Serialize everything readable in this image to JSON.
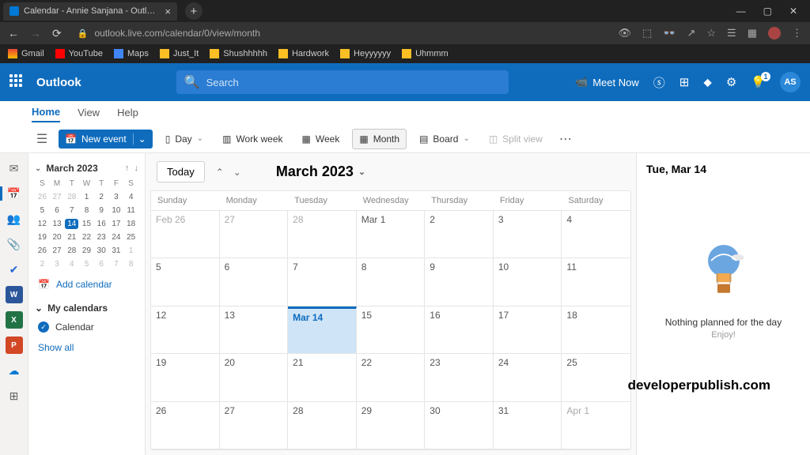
{
  "browser": {
    "tab_title": "Calendar - Annie Sanjana - Outl…",
    "url": "outlook.live.com/calendar/0/view/month",
    "bookmarks": [
      "Gmail",
      "YouTube",
      "Maps",
      "Just_It",
      "Shushhhhh",
      "Hardwork",
      "Heyyyyyy",
      "Uhmmm"
    ]
  },
  "suite": {
    "app_name": "Outlook",
    "search_placeholder": "Search",
    "meet_now": "Meet Now",
    "avatar_initials": "AS"
  },
  "ribbon_tabs": {
    "home": "Home",
    "view": "View",
    "help": "Help"
  },
  "ribbon": {
    "new_event": "New event",
    "day": "Day",
    "workweek": "Work week",
    "week": "Week",
    "month": "Month",
    "board": "Board",
    "split": "Split view"
  },
  "sidebar": {
    "month_header": "March 2023",
    "dow": [
      "S",
      "M",
      "T",
      "W",
      "T",
      "F",
      "S"
    ],
    "mini_weeks": [
      [
        {
          "d": "26",
          "dim": true
        },
        {
          "d": "27",
          "dim": true
        },
        {
          "d": "28",
          "dim": true
        },
        {
          "d": "1"
        },
        {
          "d": "2"
        },
        {
          "d": "3"
        },
        {
          "d": "4"
        }
      ],
      [
        {
          "d": "5"
        },
        {
          "d": "6"
        },
        {
          "d": "7"
        },
        {
          "d": "8"
        },
        {
          "d": "9"
        },
        {
          "d": "10"
        },
        {
          "d": "11"
        }
      ],
      [
        {
          "d": "12"
        },
        {
          "d": "13"
        },
        {
          "d": "14",
          "today": true
        },
        {
          "d": "15"
        },
        {
          "d": "16"
        },
        {
          "d": "17"
        },
        {
          "d": "18"
        }
      ],
      [
        {
          "d": "19"
        },
        {
          "d": "20"
        },
        {
          "d": "21"
        },
        {
          "d": "22"
        },
        {
          "d": "23"
        },
        {
          "d": "24"
        },
        {
          "d": "25"
        }
      ],
      [
        {
          "d": "26"
        },
        {
          "d": "27"
        },
        {
          "d": "28"
        },
        {
          "d": "29"
        },
        {
          "d": "30"
        },
        {
          "d": "31"
        },
        {
          "d": "1",
          "dim": true
        }
      ],
      [
        {
          "d": "2",
          "dim": true
        },
        {
          "d": "3",
          "dim": true
        },
        {
          "d": "4",
          "dim": true
        },
        {
          "d": "5",
          "dim": true
        },
        {
          "d": "6",
          "dim": true
        },
        {
          "d": "7",
          "dim": true
        },
        {
          "d": "8",
          "dim": true
        }
      ]
    ],
    "add_calendar": "Add calendar",
    "my_calendars": "My calendars",
    "calendar_item": "Calendar",
    "show_all": "Show all"
  },
  "calendar": {
    "today_btn": "Today",
    "title": "March 2023",
    "dow": [
      "Sunday",
      "Monday",
      "Tuesday",
      "Wednesday",
      "Thursday",
      "Friday",
      "Saturday"
    ],
    "weeks": [
      [
        {
          "l": "Feb 26",
          "o": true
        },
        {
          "l": "27",
          "o": true
        },
        {
          "l": "28",
          "o": true
        },
        {
          "l": "Mar 1"
        },
        {
          "l": "2"
        },
        {
          "l": "3"
        },
        {
          "l": "4"
        }
      ],
      [
        {
          "l": "5"
        },
        {
          "l": "6"
        },
        {
          "l": "7"
        },
        {
          "l": "8"
        },
        {
          "l": "9"
        },
        {
          "l": "10"
        },
        {
          "l": "11"
        }
      ],
      [
        {
          "l": "12"
        },
        {
          "l": "13"
        },
        {
          "l": "Mar 14",
          "t": true
        },
        {
          "l": "15"
        },
        {
          "l": "16"
        },
        {
          "l": "17"
        },
        {
          "l": "18"
        }
      ],
      [
        {
          "l": "19"
        },
        {
          "l": "20"
        },
        {
          "l": "21"
        },
        {
          "l": "22"
        },
        {
          "l": "23"
        },
        {
          "l": "24"
        },
        {
          "l": "25"
        }
      ],
      [
        {
          "l": "26"
        },
        {
          "l": "27"
        },
        {
          "l": "28"
        },
        {
          "l": "29"
        },
        {
          "l": "30"
        },
        {
          "l": "31"
        },
        {
          "l": "Apr 1",
          "o": true
        }
      ]
    ]
  },
  "rpane": {
    "title": "Tue, Mar 14",
    "msg": "Nothing planned for the day",
    "sub": "Enjoy!"
  },
  "watermark": "developerpublish.com"
}
